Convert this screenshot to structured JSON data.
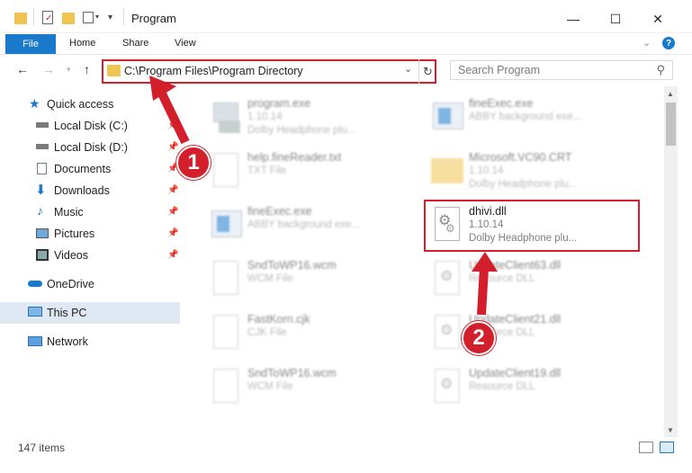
{
  "window": {
    "title": "Program",
    "minimize": "—",
    "maximize": "☐",
    "close": "✕"
  },
  "ribbon": {
    "tabs": [
      "File",
      "Home",
      "Share",
      "View"
    ],
    "help": "?"
  },
  "address_bar": {
    "path": "C:\\Program Files\\Program Directory"
  },
  "search": {
    "placeholder": "Search Program"
  },
  "sidebar": {
    "items": [
      {
        "label": "Quick access",
        "icon": "star-icon"
      },
      {
        "label": "Local Disk (C:)",
        "icon": "drive-icon"
      },
      {
        "label": "Local Disk (D:)",
        "icon": "drive-icon"
      },
      {
        "label": "Documents",
        "icon": "documents-icon"
      },
      {
        "label": "Downloads",
        "icon": "downloads-icon"
      },
      {
        "label": "Music",
        "icon": "music-icon"
      },
      {
        "label": "Pictures",
        "icon": "pictures-icon"
      },
      {
        "label": "Videos",
        "icon": "videos-icon"
      },
      {
        "label": "OneDrive",
        "icon": "cloud-icon"
      },
      {
        "label": "This PC",
        "icon": "computer-icon"
      },
      {
        "label": "Network",
        "icon": "network-icon"
      }
    ]
  },
  "files": [
    {
      "name": "program.exe",
      "line2": "1.10.14",
      "line3": "Dolby Headphone plu..."
    },
    {
      "name": "fineExec.exe",
      "line2": "ABBY background exe...",
      "line3": ""
    },
    {
      "name": "help.fineReader.txt",
      "line2": "TXT File",
      "line3": ""
    },
    {
      "name": "Microsoft.VC90.CRT",
      "line2": "1.10.14",
      "line3": "Dolby Headphone plu..."
    },
    {
      "name": "fineExec.exe",
      "line2": "ABBY background exe...",
      "line3": ""
    },
    {
      "name": "dhivi.dll",
      "line2": "1.10.14",
      "line3": "Dolby Headphone plu..."
    },
    {
      "name": "SndToWP16.wcm",
      "line2": "WCM File",
      "line3": ""
    },
    {
      "name": "UpdateClient63.dll",
      "line2": "Resource DLL",
      "line3": ""
    },
    {
      "name": "FastKorn.cjk",
      "line2": "CJK File",
      "line3": ""
    },
    {
      "name": "UpdateClient21.dll",
      "line2": "Resource DLL",
      "line3": ""
    },
    {
      "name": "SndToWP16.wcm",
      "line2": "WCM File",
      "line3": ""
    },
    {
      "name": "UpdateClient19.dll",
      "line2": "Resource DLL",
      "line3": ""
    }
  ],
  "annotations": {
    "badge1": "1",
    "badge2": "2"
  },
  "status": {
    "item_count": "147 items"
  },
  "colors": {
    "accent": "#1979ca",
    "annotation_red": "#d21f2b",
    "folder_yellow": "#f0c452"
  }
}
